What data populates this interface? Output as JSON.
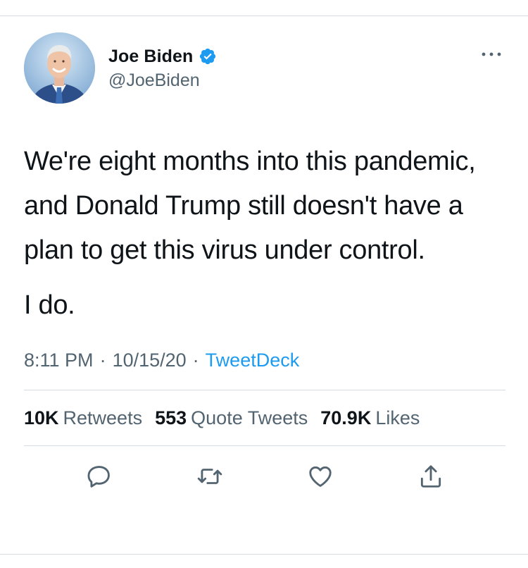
{
  "tweet": {
    "author": {
      "display_name": "Joe Biden",
      "handle": "@JoeBiden",
      "verified": true,
      "avatar_icon": "user-avatar-photo",
      "verified_icon": "verified-badge-icon"
    },
    "body": [
      "We're eight months into this pandemic, and Donald Trump still doesn't have a plan to get this virus under control.",
      "I do."
    ],
    "meta": {
      "time": "8:11 PM",
      "separator": "·",
      "date": "10/15/20",
      "source": "TweetDeck"
    },
    "stats": {
      "retweets_count": "10K",
      "retweets_label": "Retweets",
      "quotes_count": "553",
      "quotes_label": "Quote Tweets",
      "likes_count": "70.9K",
      "likes_label": "Likes"
    },
    "actions": [
      "reply-icon",
      "retweet-icon",
      "like-icon",
      "share-icon"
    ]
  },
  "colors": {
    "text_primary": "#0f1419",
    "text_secondary": "#536471",
    "accent": "#1d9bf0",
    "divider": "#d6dbdf"
  }
}
